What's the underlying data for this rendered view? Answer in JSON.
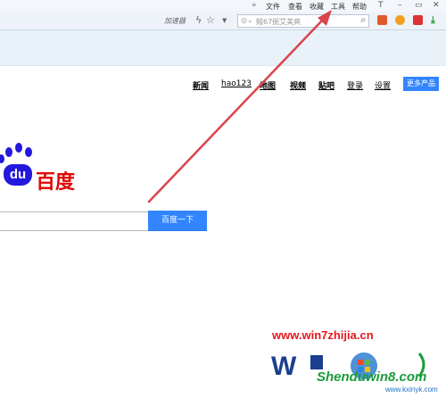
{
  "menubar": {
    "arrows": "»",
    "items": [
      "文件",
      "查看",
      "收藏",
      "工具",
      "帮助"
    ],
    "window_controls": [
      "T",
      "–",
      "▭",
      "✕"
    ]
  },
  "toolbar": {
    "accelerator_label": "加速器",
    "search_engine_icon": "search-engine-icon",
    "search_placeholder": "賊67掘艾美爽",
    "search_icon": "🔍"
  },
  "page": {
    "nav_links": [
      "新闻",
      "hao123",
      "地图",
      "视频",
      "贴吧",
      "登录",
      "设置"
    ],
    "more_products": "更多产品",
    "logo_du": "du",
    "logo_text": "百度",
    "search_value": "",
    "search_button": "百度一下"
  },
  "watermark": {
    "url": "www.win7zhijia.cn",
    "site_name": "Shenduwin8.com",
    "site_url": "www.kxinyk.com"
  },
  "colors": {
    "baidu_blue": "#3385ff",
    "baidu_red": "#e10601",
    "logo_blue": "#2319dc",
    "arrow_red": "#d9454b"
  }
}
